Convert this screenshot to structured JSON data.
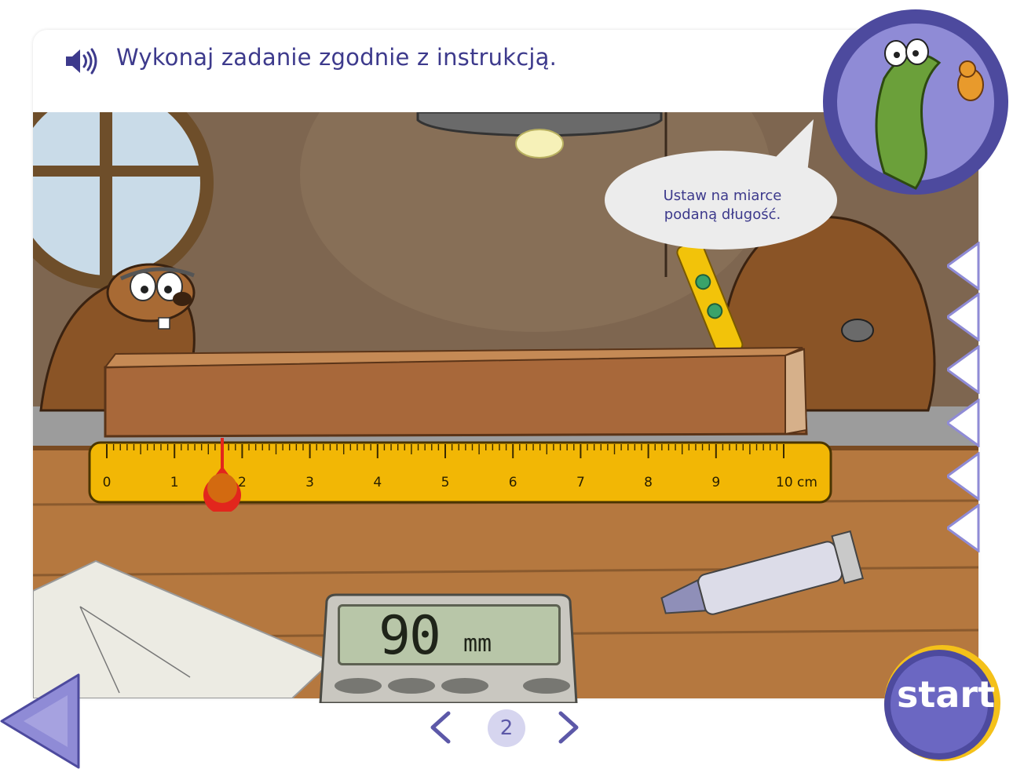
{
  "header": {
    "instruction": "Wykonaj zadanie zgodnie z instrukcją.",
    "speaker_icon": "speaker-icon"
  },
  "bubble": {
    "line1": "Ustaw na miarce",
    "line2": "podaną długość."
  },
  "ruler": {
    "labels": [
      "0",
      "1",
      "2",
      "3",
      "4",
      "5",
      "6",
      "7",
      "8",
      "9",
      "10 cm"
    ],
    "min_cm": 0,
    "max_cm": 10,
    "slider_value_cm": 1.7
  },
  "display": {
    "value": "90",
    "unit": "mm"
  },
  "nav": {
    "page_number": "2"
  },
  "start_button": {
    "label": "start"
  },
  "colors": {
    "brand_purple": "#5c58a8",
    "ruler_yellow": "#f2b705",
    "slider_red": "#e2261d",
    "wood": "#a8683a"
  }
}
